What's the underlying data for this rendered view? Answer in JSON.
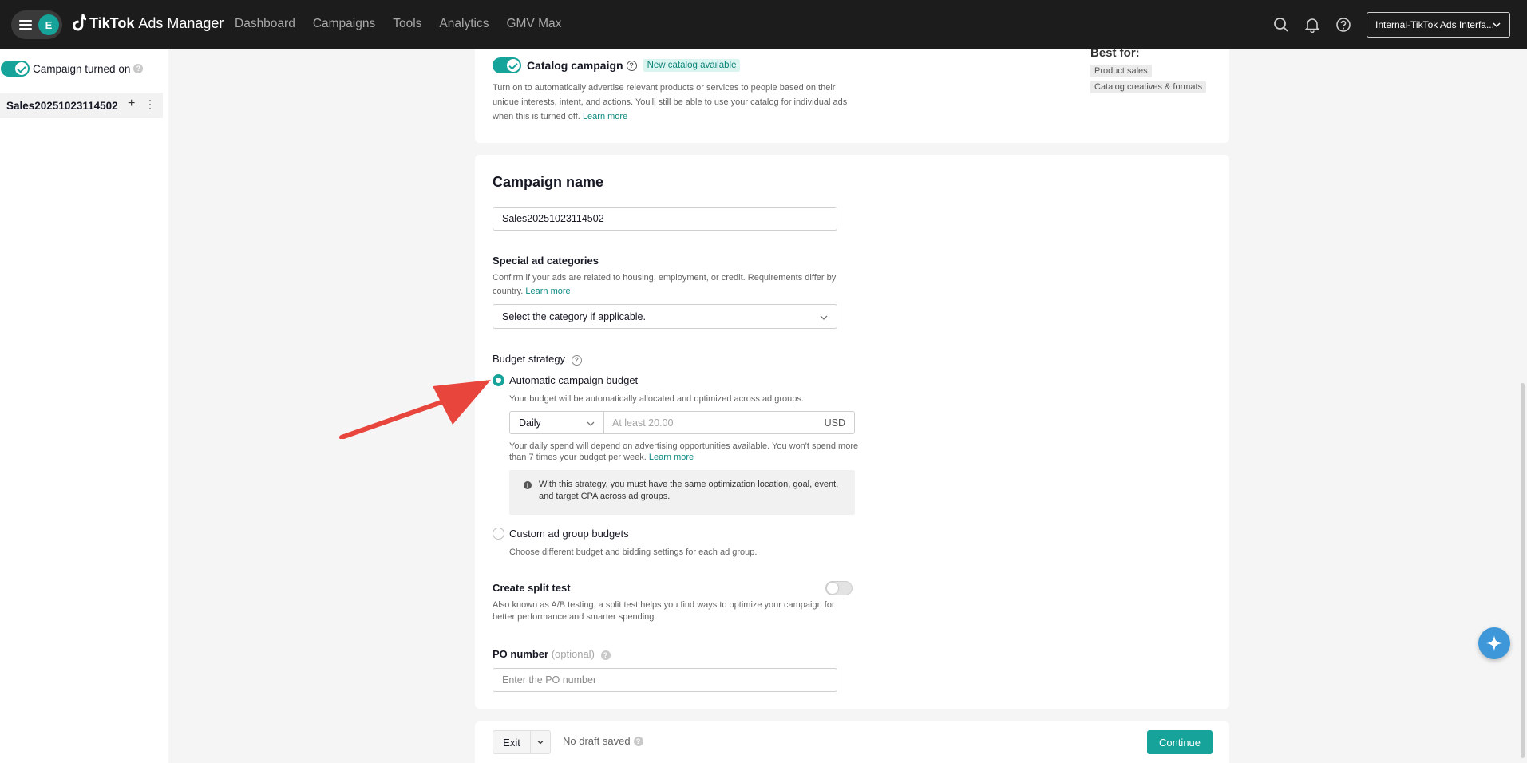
{
  "topbar": {
    "avatar_letter": "E",
    "brand_name": "TikTok",
    "brand_suffix": "Ads Manager",
    "nav": [
      "Dashboard",
      "Campaigns",
      "Tools",
      "Analytics",
      "GMV Max"
    ],
    "account_label": "Internal-TikTok Ads Interfa..."
  },
  "sidebar": {
    "toggle_label": "Campaign turned on",
    "campaign_name": "Sales20251023114502"
  },
  "catalog": {
    "title": "Catalog campaign",
    "badge": "New catalog available",
    "description": "Turn on to automatically advertise relevant products or services to people based on their unique interests, intent, and actions. You'll still be able to use your catalog for individual ads when this is turned off.",
    "learn_more": "Learn more",
    "best_for_heading": "Best for:",
    "best_for_tags": [
      "Product sales",
      "Catalog creatives & formats"
    ]
  },
  "campaign": {
    "section_title": "Campaign name",
    "name_value": "Sales20251023114502",
    "special_label": "Special ad categories",
    "special_desc": "Confirm if your ads are related to housing, employment, or credit. Requirements differ by country.",
    "special_learn_more": "Learn more",
    "special_placeholder": "Select the category if applicable.",
    "budget_label": "Budget strategy",
    "auto_label": "Automatic campaign budget",
    "auto_desc": "Your budget will be automatically allocated and optimized across ad groups.",
    "budget_period": "Daily",
    "budget_placeholder": "At least 20.00",
    "currency": "USD",
    "spend_note": "Your daily spend will depend on advertising opportunities available. You won't spend more than 7 times your budget per week.",
    "spend_learn_more": "Learn more",
    "info_text": "With this strategy, you must have the same optimization location, goal, event, and target CPA across ad groups.",
    "custom_label": "Custom ad group budgets",
    "custom_desc": "Choose different budget and bidding settings for each ad group.",
    "split_label": "Create split test",
    "split_desc": "Also known as A/B testing, a split test helps you find ways to optimize your campaign for better performance and smarter spending.",
    "po_label": "PO number",
    "po_optional": "(optional)",
    "po_placeholder": "Enter the PO number"
  },
  "footer": {
    "exit_label": "Exit",
    "draft_status": "No draft saved",
    "continue_label": "Continue"
  },
  "colors": {
    "accent": "#15a39a",
    "topbar": "#1c1c1c",
    "annotation_arrow": "#e8453c"
  }
}
